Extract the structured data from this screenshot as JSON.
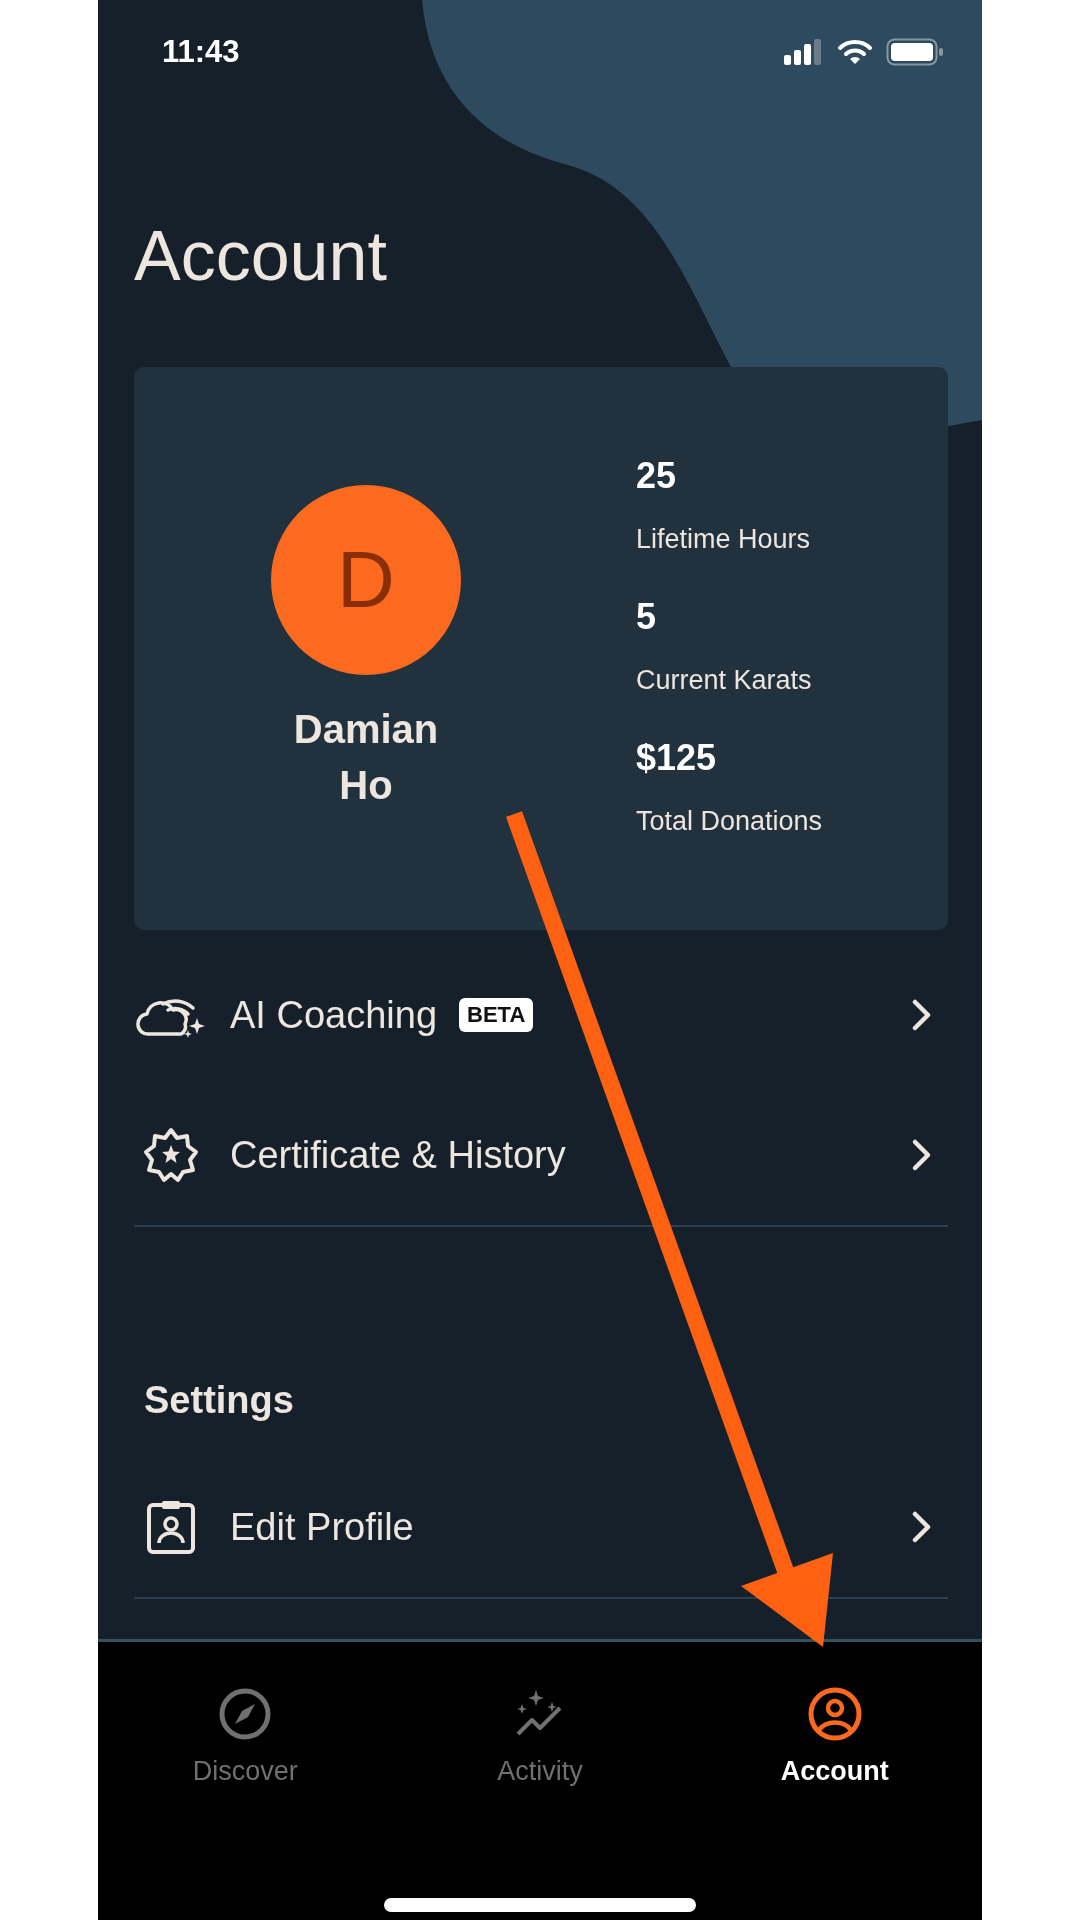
{
  "status_bar": {
    "time": "11:43"
  },
  "title": "Account",
  "profile": {
    "initial": "D",
    "name": "Damian Ho",
    "stats": [
      {
        "value": "25",
        "label": "Lifetime Hours"
      },
      {
        "value": "5",
        "label": "Current Karats"
      },
      {
        "value": "$125",
        "label": "Total Donations"
      }
    ]
  },
  "menu": [
    {
      "kind": "ai",
      "label": "AI Coaching",
      "badge": "BETA"
    },
    {
      "kind": "certificate",
      "label": "Certificate & History"
    }
  ],
  "settings": {
    "heading": "Settings",
    "items": [
      {
        "kind": "profile",
        "label": "Edit Profile"
      }
    ]
  },
  "tabs": [
    {
      "kind": "compass",
      "label": "Discover",
      "selected": false
    },
    {
      "kind": "activity",
      "label": "Activity",
      "selected": false
    },
    {
      "kind": "user",
      "label": "Account",
      "selected": true
    }
  ]
}
